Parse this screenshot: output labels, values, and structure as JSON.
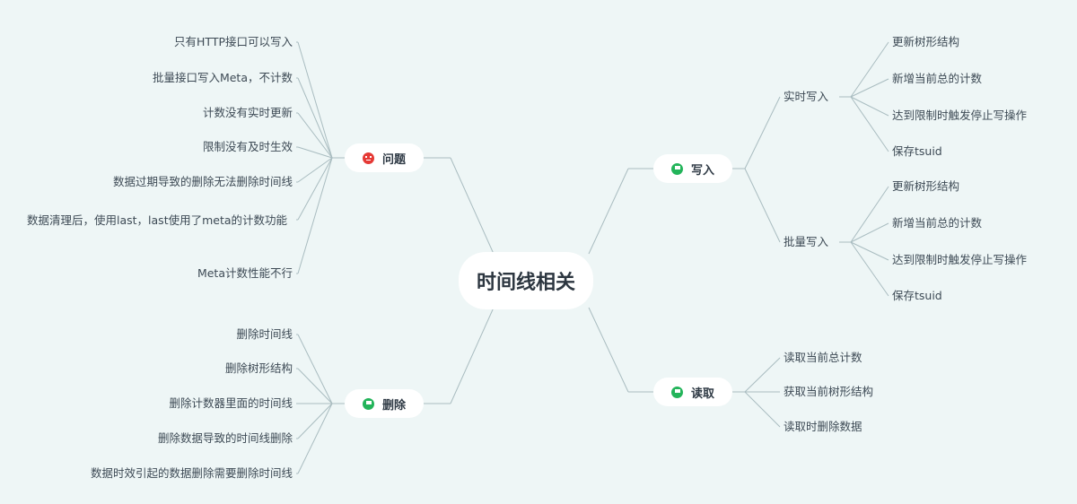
{
  "root": "时间线相关",
  "problem": {
    "label": "问题",
    "icon": "red-face-icon",
    "items": [
      "只有HTTP接口可以写入",
      "批量接口写入Meta，不计数",
      "计数没有实时更新",
      "限制没有及时生效",
      "数据过期导致的删除无法删除时间线",
      "数据清理后，使用last，last使用了meta的计数功能",
      "Meta计数性能不行"
    ]
  },
  "delete": {
    "label": "删除",
    "icon": "green-flag-icon",
    "items": [
      "删除时间线",
      "删除树形结构",
      "删除计数器里面的时间线",
      "删除数据导致的时间线删除",
      "数据时效引起的数据删除需要删除时间线"
    ]
  },
  "write": {
    "label": "写入",
    "icon": "green-flag-icon",
    "realtime": {
      "label": "实时写入",
      "items": [
        "更新树形结构",
        "新增当前总的计数",
        "达到限制时触发停止写操作",
        "保存tsuid"
      ]
    },
    "batch": {
      "label": "批量写入",
      "items": [
        "更新树形结构",
        "新增当前总的计数",
        "达到限制时触发停止写操作",
        "保存tsuid"
      ]
    }
  },
  "read": {
    "label": "读取",
    "icon": "green-flag-icon",
    "items": [
      "读取当前总计数",
      "获取当前树形结构",
      "读取时删除数据"
    ]
  },
  "colors": {
    "background": "#eef6f6",
    "line": "#a9bcc0",
    "flag": "#23b45a",
    "alert": "#e53935"
  }
}
